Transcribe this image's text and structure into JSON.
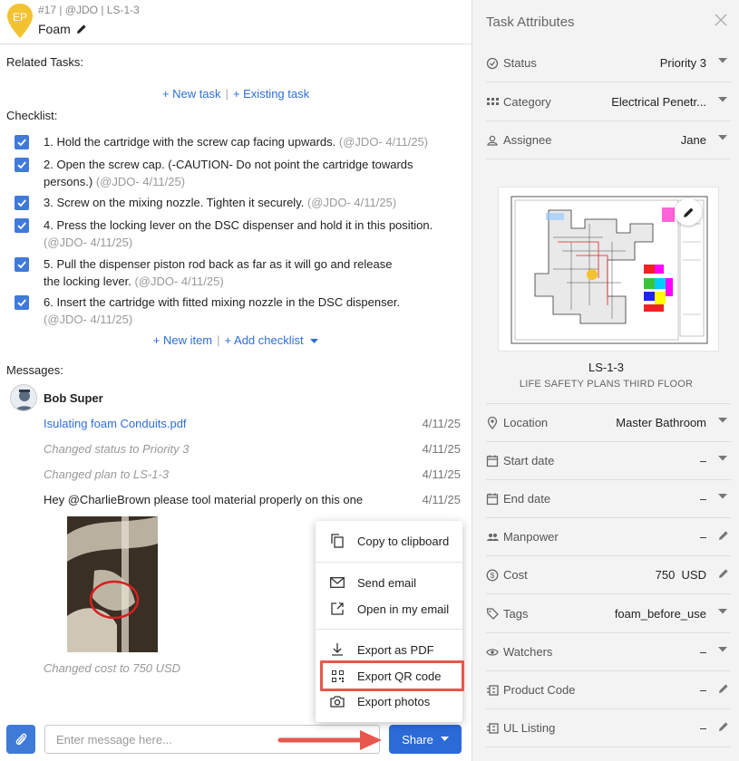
{
  "header": {
    "pin_initials": "EP",
    "task_ref": "#17 | @JDO | LS-1-3",
    "title": "Foam"
  },
  "related": {
    "label": "Related Tasks:",
    "new_task": "+ New task",
    "separator": "|",
    "existing_task": "+ Existing task"
  },
  "checklist": {
    "label": "Checklist:",
    "items": [
      {
        "text": "1. Hold the cartridge with the screw cap facing upwards.",
        "meta": "(@JDO- 4/11/25)",
        "checked": true
      },
      {
        "text": "2. Open the screw cap. (-CAUTION- Do not point the cartridge towards persons.)",
        "meta": "(@JDO- 4/11/25)",
        "checked": true
      },
      {
        "text": "3. Screw on the mixing nozzle. Tighten it securely.",
        "meta": "(@JDO- 4/11/25)",
        "checked": true
      },
      {
        "text": "4. Press the locking lever on the DSC dispenser and hold it in this position.",
        "meta": "(@JDO- 4/11/25)",
        "checked": true
      },
      {
        "text": "5. Pull the dispenser piston rod back as far as it will go and release the locking lever.",
        "meta": "(@JDO- 4/11/25)",
        "checked": true
      },
      {
        "text": "6. Insert the cartridge with fitted mixing nozzle in the DSC dispenser.",
        "meta": "(@JDO- 4/11/25)",
        "checked": true
      }
    ],
    "new_item": "+ New item",
    "separator": "|",
    "add_checklist": "+ Add checklist"
  },
  "messages": {
    "label": "Messages:",
    "author": "Bob Super",
    "entries": [
      {
        "text": "Isulating foam Conduits.pdf",
        "date": "4/11/25"
      },
      {
        "text": "Changed status to Priority 3",
        "date": "4/11/25"
      },
      {
        "text": "Changed plan to LS-1-3",
        "date": "4/11/25"
      },
      {
        "text": "Hey @CharlieBrown please tool material properly on this one",
        "date": "4/11/25"
      }
    ],
    "last_entry": "Changed cost to 750 USD"
  },
  "composer": {
    "placeholder": "Enter message here...",
    "share_label": "Share"
  },
  "share_menu": {
    "items": [
      {
        "label": "Copy to clipboard",
        "icon": "copy-icon"
      },
      {
        "label": "Send email",
        "icon": "mail-icon"
      },
      {
        "label": "Open in my email",
        "icon": "external-link-icon"
      },
      {
        "label": "Export as PDF",
        "icon": "download-icon"
      },
      {
        "label": "Export QR code",
        "icon": "qr-code-icon"
      },
      {
        "label": "Export photos",
        "icon": "camera-icon"
      }
    ]
  },
  "attributes": {
    "title": "Task Attributes",
    "rows_top": [
      {
        "label": "Status",
        "value": "Priority 3",
        "icon": "status-check-icon",
        "action": "dropdown"
      },
      {
        "label": "Category",
        "value": "Electrical Penetr...",
        "icon": "grid-icon",
        "action": "dropdown"
      },
      {
        "label": "Assignee",
        "value": "Jane",
        "icon": "person-icon",
        "action": "dropdown"
      }
    ],
    "plan": {
      "code": "LS-1-3",
      "name": "LIFE SAFETY PLANS THIRD FLOOR"
    },
    "rows_bottom": [
      {
        "label": "Location",
        "value": "Master Bathroom",
        "icon": "location-pin-icon",
        "action": "dropdown"
      },
      {
        "label": "Start date",
        "value": "–",
        "icon": "calendar-icon",
        "action": "dropdown"
      },
      {
        "label": "End date",
        "value": "–",
        "icon": "calendar-icon",
        "action": "dropdown"
      },
      {
        "label": "Manpower",
        "value": "–",
        "icon": "people-icon",
        "action": "edit"
      },
      {
        "label": "Cost",
        "value": "750  USD",
        "icon": "dollar-icon",
        "action": "edit"
      },
      {
        "label": "Tags",
        "value": "foam_before_use",
        "icon": "tag-icon",
        "action": "dropdown"
      },
      {
        "label": "Watchers",
        "value": "–",
        "icon": "eye-icon",
        "action": "dropdown"
      },
      {
        "label": "Product Code",
        "value": "–",
        "icon": "custom-field-icon",
        "action": "edit"
      },
      {
        "label": "UL Listing",
        "value": "–",
        "icon": "custom-field-icon",
        "action": "edit"
      }
    ]
  },
  "colors": {
    "accent": "#2c6ad8",
    "checkbox": "#3f7ad9",
    "pin": "#f2c230",
    "highlight": "#e8574c",
    "panel": "#f3f3f3"
  }
}
